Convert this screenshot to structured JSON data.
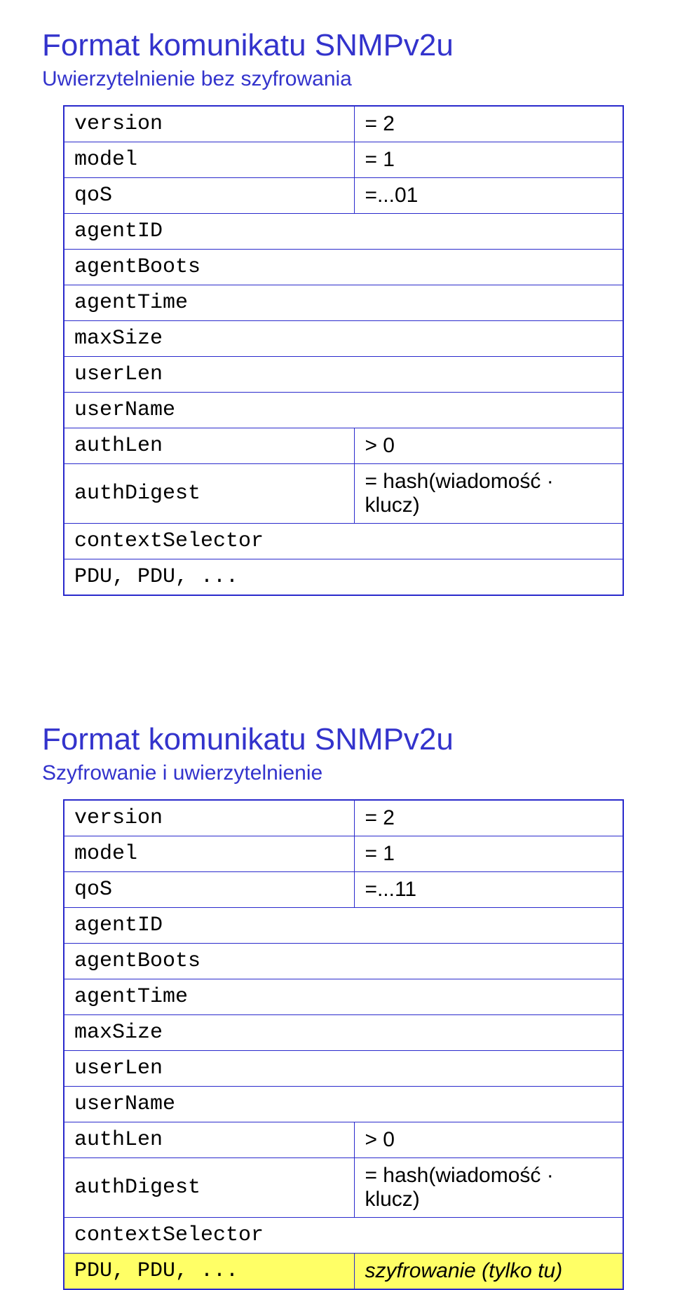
{
  "slide1": {
    "title": "Format komunikatu SNMPv2u",
    "subtitle": "Uwierzytelnienie bez szyfrowania",
    "rows": [
      {
        "name": "version",
        "val": "= 2"
      },
      {
        "name": "model",
        "val": "= 1"
      },
      {
        "name": "qoS",
        "val": "=...01"
      },
      {
        "name": "agentID",
        "val": ""
      },
      {
        "name": "agentBoots",
        "val": ""
      },
      {
        "name": "agentTime",
        "val": ""
      },
      {
        "name": "maxSize",
        "val": ""
      },
      {
        "name": "userLen",
        "val": ""
      },
      {
        "name": "userName",
        "val": ""
      },
      {
        "name": "authLen",
        "val": "> 0"
      },
      {
        "name": "authDigest",
        "val": "= hash(wiadomość · klucz)"
      },
      {
        "name": "contextSelector",
        "val": ""
      },
      {
        "name": "PDU, PDU, ...",
        "val": ""
      }
    ]
  },
  "slide2": {
    "title": "Format komunikatu SNMPv2u",
    "subtitle": "Szyfrowanie i uwierzytelnienie",
    "rows": [
      {
        "name": "version",
        "val": "= 2"
      },
      {
        "name": "model",
        "val": "= 1"
      },
      {
        "name": "qoS",
        "val": "=...11"
      },
      {
        "name": "agentID",
        "val": ""
      },
      {
        "name": "agentBoots",
        "val": ""
      },
      {
        "name": "agentTime",
        "val": ""
      },
      {
        "name": "maxSize",
        "val": ""
      },
      {
        "name": "userLen",
        "val": ""
      },
      {
        "name": "userName",
        "val": ""
      },
      {
        "name": "authLen",
        "val": "> 0"
      },
      {
        "name": "authDigest",
        "val": "= hash(wiadomość · klucz)"
      },
      {
        "name": "contextSelector",
        "val": ""
      },
      {
        "name": "PDU, PDU, ...",
        "val": "szyfrowanie (tylko tu)",
        "highlight": true,
        "valItalic": true
      }
    ]
  }
}
